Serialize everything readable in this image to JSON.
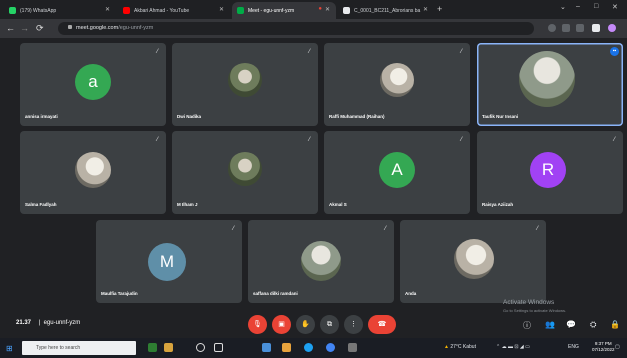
{
  "browser": {
    "tabs": [
      {
        "title": "(179) WhatsApp",
        "color": "#25d366"
      },
      {
        "title": "Akbari Ahmad - YouTube",
        "color": "#ff0000"
      },
      {
        "title": "Meet - egu-unnf-yzm",
        "color": "#00ac47",
        "active": true
      },
      {
        "title": "C_0001_BC211_Abrorians ba",
        "color": "#e8eaed"
      }
    ],
    "new_tab": "+",
    "url_host": "meet.google.com",
    "url_path": "/egu-unnf-yzm"
  },
  "participants": [
    {
      "name": "annisa irmayati",
      "initial": "a",
      "avatar_color": "#34a853",
      "type": "initial"
    },
    {
      "name": "Dwi Nadika",
      "type": "photo"
    },
    {
      "name": "Raffi Muhammad (Raihan)",
      "type": "photo"
    },
    {
      "name": "Taufik Nur Insani",
      "type": "photo",
      "speaking": true
    },
    {
      "name": "Salma Fadlyah",
      "type": "photo"
    },
    {
      "name": "M Ilham J",
      "type": "photo"
    },
    {
      "name": "Akmal S",
      "initial": "A",
      "avatar_color": "#34a853",
      "type": "initial"
    },
    {
      "name": "Raisya Aziizah",
      "initial": "R",
      "avatar_color": "#a142f4",
      "type": "initial"
    },
    {
      "name": "Maulfia Tarajudin",
      "initial": "M",
      "avatar_color": "#5f8fa8",
      "type": "initial"
    },
    {
      "name": "saffana dilki ramdani",
      "type": "photo"
    },
    {
      "name": "Anda",
      "type": "photo"
    }
  ],
  "meeting": {
    "time": "21.37",
    "code": "egu-unnf-yzm"
  },
  "windows": {
    "activate_title": "Activate Windows",
    "activate_sub": "Go to Settings to activate Windows.",
    "search_placeholder": "Type here to search",
    "weather": "27°C Kabut",
    "lang": "ENG",
    "clock_time": "9:37 PM",
    "clock_date": "07/12/2022"
  }
}
